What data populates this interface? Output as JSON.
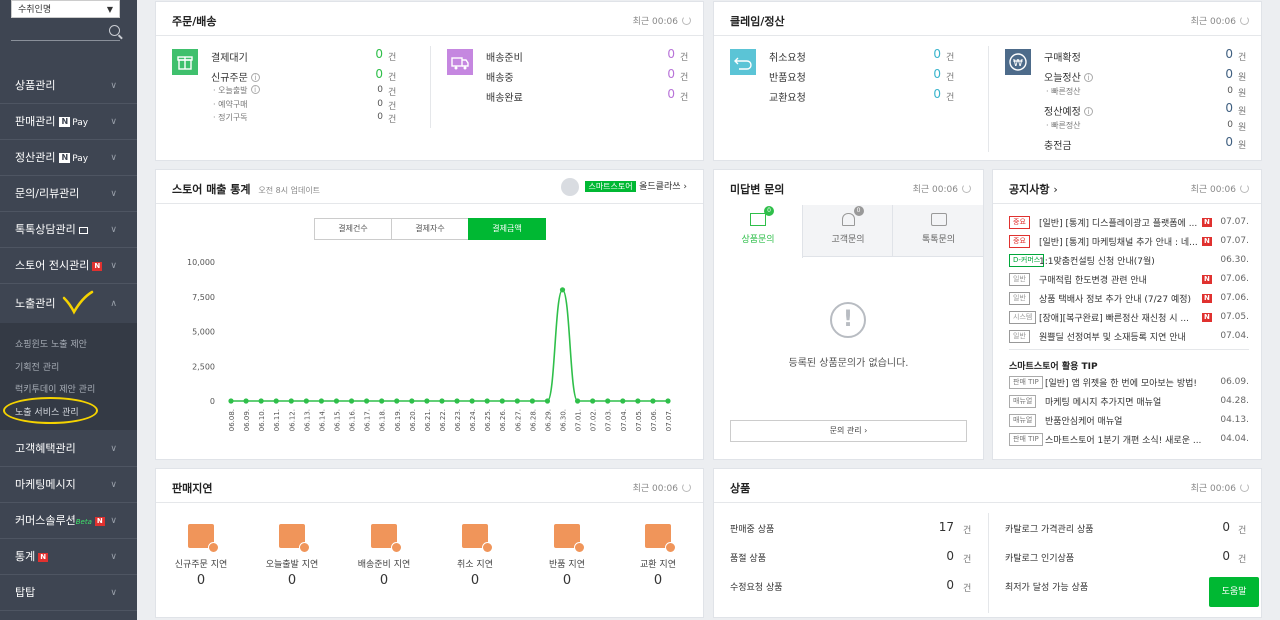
{
  "sidebar": {
    "store_name": "수취인명",
    "menus": [
      {
        "label": "상품관리"
      },
      {
        "label": "판매관리",
        "badge": "N",
        "badge_suffix": "Pay"
      },
      {
        "label": "정산관리",
        "badge": "N",
        "badge_suffix": "Pay"
      },
      {
        "label": "문의/리뷰관리"
      },
      {
        "label": "톡톡상담관리",
        "icon": "talk-icon"
      },
      {
        "label": "스토어 전시관리",
        "new": "N"
      },
      {
        "label": "노출관리"
      },
      {
        "label": "고객혜택관리"
      },
      {
        "label": "마케팅메시지"
      },
      {
        "label": "커머스솔루션",
        "beta": "Beta",
        "new": "N"
      },
      {
        "label": "통계",
        "new": "N"
      },
      {
        "label": "탑탑"
      }
    ],
    "submenu": [
      "쇼핑윈도 노출 제안",
      "기획전 관리",
      "럭키투데이 제안 관리",
      "노출 서비스 관리"
    ]
  },
  "order": {
    "title": "주문/배송",
    "updated": "최근 00:06",
    "pay_wait": {
      "label": "결제대기",
      "value": "0",
      "unit": "건"
    },
    "new_order": {
      "label": "신규주문",
      "value": "0",
      "unit": "건"
    },
    "today_ship": {
      "label": "오늘출발",
      "value": "0",
      "unit": "건"
    },
    "reserve": {
      "label": "예약구매",
      "value": "0",
      "unit": "건"
    },
    "subscribe": {
      "label": "정기구독",
      "value": "0",
      "unit": "건"
    },
    "ship_ready": {
      "label": "배송준비",
      "value": "0",
      "unit": "건"
    },
    "shipping": {
      "label": "배송중",
      "value": "0",
      "unit": "건"
    },
    "ship_done": {
      "label": "배송완료",
      "value": "0",
      "unit": "건"
    }
  },
  "claim": {
    "title": "클레임/정산",
    "updated": "최근 00:06",
    "cancel": {
      "label": "취소요청",
      "value": "0",
      "unit": "건"
    },
    "return": {
      "label": "반품요청",
      "value": "0",
      "unit": "건"
    },
    "exchange": {
      "label": "교환요청",
      "value": "0",
      "unit": "건"
    },
    "confirm": {
      "label": "구매확정",
      "value": "0",
      "unit": "건"
    },
    "today_settle": {
      "label": "오늘정산",
      "value": "0",
      "unit": "원"
    },
    "fast1": {
      "label": "빠른정산",
      "value": "0",
      "unit": "원"
    },
    "settle_plan": {
      "label": "정산예정",
      "value": "0",
      "unit": "원"
    },
    "fast2": {
      "label": "빠른정산",
      "value": "0",
      "unit": "원"
    },
    "charge": {
      "label": "충전금",
      "value": "0",
      "unit": "원"
    }
  },
  "sales": {
    "title": "스토어 매출 통계",
    "updated": "오전 8시 업데이트",
    "store_badge": "스마트스토어",
    "store_name": "올드클라쓰 ›",
    "tabs": [
      "결제건수",
      "결제자수",
      "결제금액"
    ]
  },
  "chart_data": {
    "type": "line",
    "categories": [
      "06.08.",
      "06.09.",
      "06.10.",
      "06.11.",
      "06.12.",
      "06.13.",
      "06.14.",
      "06.15.",
      "06.16.",
      "06.17.",
      "06.18.",
      "06.19.",
      "06.20.",
      "06.21.",
      "06.22.",
      "06.23.",
      "06.24.",
      "06.25.",
      "06.26.",
      "06.27.",
      "06.28.",
      "06.29.",
      "06.30.",
      "07.01.",
      "07.02.",
      "07.03.",
      "07.04.",
      "07.05.",
      "07.06.",
      "07.07."
    ],
    "series": [
      {
        "values": [
          0,
          0,
          0,
          0,
          0,
          0,
          0,
          0,
          0,
          0,
          0,
          0,
          0,
          0,
          0,
          0,
          0,
          0,
          0,
          0,
          0,
          0,
          8000,
          0,
          0,
          0,
          0,
          0,
          0,
          0
        ]
      }
    ],
    "yticks": [
      "10,000",
      "7,500",
      "5,000",
      "2,500",
      "0"
    ],
    "ylim": [
      0,
      10000
    ],
    "color": "#2fbf4a",
    "grid": false
  },
  "inquiry": {
    "title": "미답변 문의",
    "updated": "최근 00:06",
    "tabs": [
      {
        "label": "상품문의",
        "count": "0"
      },
      {
        "label": "고객문의",
        "count": "0"
      },
      {
        "label": "톡톡문의"
      }
    ],
    "empty": "등록된 상품문의가 없습니다.",
    "manage": "문의 관리 ›"
  },
  "notice": {
    "title": "공지사항",
    "updated": "최근 00:06",
    "items": [
      {
        "tag": "중요",
        "text": "[일반] [통계] 디스플레이광고 플랫폼에 ...",
        "date": "07.07.",
        "new": "N",
        "color": "#e0312f"
      },
      {
        "tag": "중요",
        "text": "[일반] [통계] 마케팅채널 추가 안내 : 네...",
        "date": "07.07.",
        "new": "N",
        "color": "#e0312f"
      },
      {
        "tag": "D-커머스",
        "text": "1:1맞춤컨설팅 신청 안내(7월)",
        "date": "06.30.",
        "color": "#00a63a"
      },
      {
        "tag": "일반",
        "text": "구매적립 한도변경 관련 안내",
        "date": "07.06.",
        "new": "N"
      },
      {
        "tag": "일반",
        "text": "상품 택배사 정보 추가 안내 (7/27 예정)",
        "date": "07.06.",
        "new": "N"
      },
      {
        "tag": "시스템",
        "text": "[장애][복구완료] 빠른정산 재신청 시 ...",
        "date": "07.05.",
        "new": "N"
      },
      {
        "tag": "일반",
        "text": "원쁠딜 선정여부 및 소재등록 지연 안내",
        "date": "07.04."
      }
    ],
    "tip_title": "스마트스토어 활용 TIP",
    "tips": [
      {
        "tag": "판매 TIP",
        "text": "[일반] 앱 위젯을 한 번에 모아보는 방법!",
        "date": "06.09."
      },
      {
        "tag": "매뉴얼",
        "text": "마케팅 메시지 추가지면 매뉴얼",
        "date": "04.28."
      },
      {
        "tag": "매뉴얼",
        "text": "반품안심케어 매뉴얼",
        "date": "04.13."
      },
      {
        "tag": "판매 TIP",
        "text": "스마트스토어 1분기 개편 소식! 새로운 ...",
        "date": "04.04."
      }
    ]
  },
  "delay": {
    "title": "판매지연",
    "updated": "최근 00:06",
    "items": [
      {
        "label": "신규주문 지연",
        "value": "0"
      },
      {
        "label": "오늘출발 지연",
        "value": "0"
      },
      {
        "label": "배송준비 지연",
        "value": "0"
      },
      {
        "label": "취소 지연",
        "value": "0"
      },
      {
        "label": "반품 지연",
        "value": "0"
      },
      {
        "label": "교환 지연",
        "value": "0"
      }
    ]
  },
  "product": {
    "title": "상품",
    "updated": "최근 00:06",
    "left": [
      {
        "label": "판매중 상품",
        "value": "17",
        "unit": "건"
      },
      {
        "label": "품절 상품",
        "value": "0",
        "unit": "건"
      },
      {
        "label": "수정요청 상품",
        "value": "0",
        "unit": "건"
      }
    ],
    "right": [
      {
        "label": "카탈로그 가격관리 상품",
        "value": "0",
        "unit": "건"
      },
      {
        "label": "카탈로그 인기상품",
        "value": "0",
        "unit": "건"
      },
      {
        "label": "최저가 달성 가능 상품"
      }
    ],
    "help": "도움말"
  }
}
